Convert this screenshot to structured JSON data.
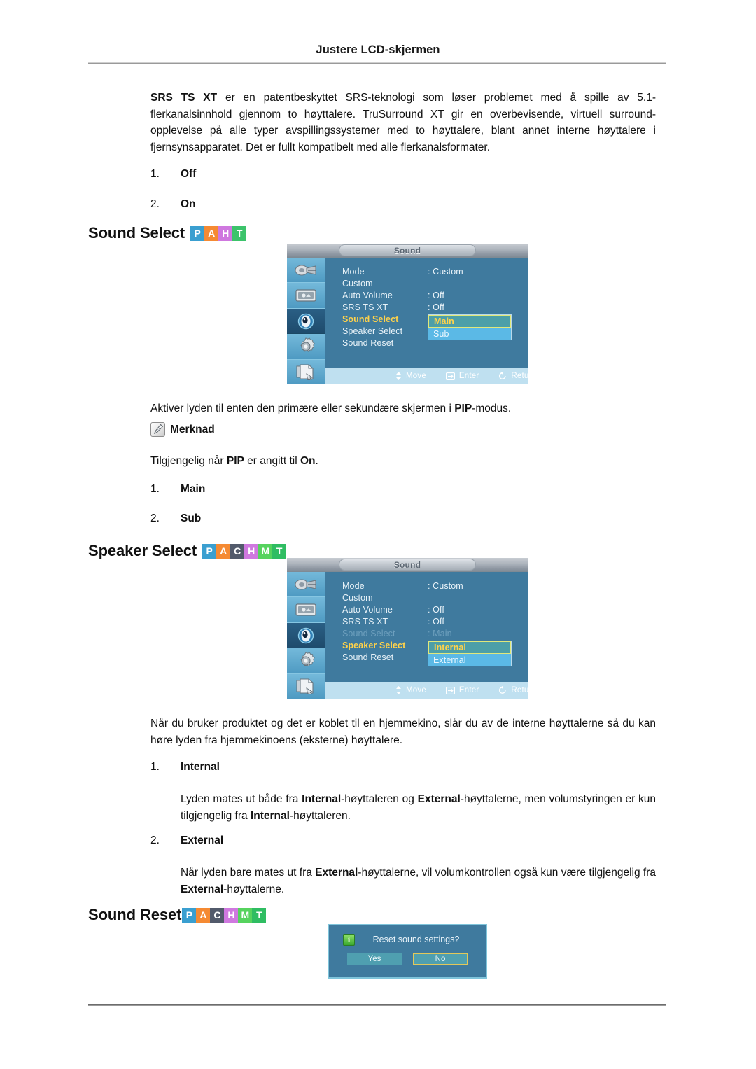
{
  "page": {
    "header_title": "Justere LCD-skjermen"
  },
  "intro": {
    "bold_lead": "SRS TS XT",
    "text": " er en patentbeskyttet SRS-teknologi som løser problemet med å spille av 5.1-flerkanalsinnhold gjennom to høyttalere. TruSurround XT gir en overbevisende, virtuell surround-opplevelse på alle typer avspillingssystemer med to høyttalere, blant annet interne høyttalere i fjernsynsapparatet. Det er fullt kompatibelt med alle flerkanalsformater.",
    "items": [
      {
        "num": "1.",
        "label": "Off"
      },
      {
        "num": "2.",
        "label": "On"
      }
    ]
  },
  "section_sound_select": {
    "heading": "Sound Select",
    "badges": [
      {
        "letter": "P",
        "color": "#3a9fd0"
      },
      {
        "letter": "A",
        "color": "#f58a33"
      },
      {
        "letter": "H",
        "color": "#cf78df"
      },
      {
        "letter": "T",
        "color": "#3cc36b"
      }
    ],
    "caption_pre": "Aktiver lyden til enten den primære eller sekundære skjermen i ",
    "caption_bold": "PIP",
    "caption_post": "-modus.",
    "note_label": "Merknad",
    "note_pre": "Tilgjengelig når ",
    "note_bold1": "PIP",
    "note_mid": " er angitt til ",
    "note_bold2": "On",
    "note_post": ".",
    "items": [
      {
        "num": "1.",
        "label": "Main"
      },
      {
        "num": "2.",
        "label": "Sub"
      }
    ]
  },
  "section_speaker_select": {
    "heading": "Speaker Select",
    "badges": [
      {
        "letter": "P",
        "color": "#3a9fd0"
      },
      {
        "letter": "A",
        "color": "#f58a33"
      },
      {
        "letter": "C",
        "color": "#525a6b"
      },
      {
        "letter": "H",
        "color": "#cf78df"
      },
      {
        "letter": "M",
        "color": "#56d35e"
      },
      {
        "letter": "T",
        "color": "#2fbd62"
      }
    ],
    "paragraph": "Når du bruker produktet og det er koblet til en hjemmekino, slår du av de interne høyttalerne så du kan høre lyden fra hjemmekinoens (eksterne) høyttalere.",
    "item1_num": "1.",
    "item1_label": "Internal",
    "item1_body_a": "Lyden mates ut både fra ",
    "item1_body_b": "Internal",
    "item1_body_c": "-høyttaleren og ",
    "item1_body_d": "External",
    "item1_body_e": "-høyttalerne, men volumstyringen er kun tilgjengelig fra ",
    "item1_body_f": "Internal",
    "item1_body_g": "-høyttaleren.",
    "item2_num": "2.",
    "item2_label": "External",
    "item2_body_a": "Når lyden bare mates ut fra ",
    "item2_body_b": "External",
    "item2_body_c": "-høyttalerne, vil volumkontrollen også kun være tilgjengelig fra ",
    "item2_body_d": "External",
    "item2_body_e": "-høyttalerne."
  },
  "section_sound_reset": {
    "heading": "Sound Reset",
    "badges": [
      {
        "letter": "P",
        "color": "#3a9fd0"
      },
      {
        "letter": "A",
        "color": "#f58a33"
      },
      {
        "letter": "C",
        "color": "#525a6b"
      },
      {
        "letter": "H",
        "color": "#cf78df"
      },
      {
        "letter": "M",
        "color": "#56d35e"
      },
      {
        "letter": "T",
        "color": "#2fbd62"
      }
    ]
  },
  "osd_menu_1": {
    "title": "Sound",
    "rows": [
      {
        "label": "Mode",
        "value": ": Custom",
        "state": "normal"
      },
      {
        "label": "Custom",
        "value": "",
        "state": "normal"
      },
      {
        "label": "Auto Volume",
        "value": ": Off",
        "state": "normal"
      },
      {
        "label": "SRS TS XT",
        "value": ": Off",
        "state": "normal"
      },
      {
        "label": "Sound Select",
        "value": ":",
        "state": "selected"
      },
      {
        "label": "Speaker Select",
        "value": "",
        "state": "normal"
      },
      {
        "label": "Sound Reset",
        "value": "",
        "state": "normal"
      }
    ],
    "dropdown": [
      {
        "label": "Main",
        "state": "highlighted"
      },
      {
        "label": "Sub",
        "state": "plain"
      }
    ],
    "nav": [
      {
        "icon": "move-updown-icon",
        "label": "Move"
      },
      {
        "icon": "enter-icon",
        "label": "Enter"
      },
      {
        "icon": "return-icon",
        "label": "Return"
      }
    ],
    "rail": [
      "input-source-icon",
      "picture-screen-icon",
      "sound-speaker-icon",
      "setup-gear-icon",
      "multi-control-icon"
    ]
  },
  "osd_menu_2": {
    "title": "Sound",
    "rows": [
      {
        "label": "Mode",
        "value": ": Custom",
        "state": "normal"
      },
      {
        "label": "Custom",
        "value": "",
        "state": "normal"
      },
      {
        "label": "Auto Volume",
        "value": ": Off",
        "state": "normal"
      },
      {
        "label": "SRS TS XT",
        "value": ": Off",
        "state": "normal"
      },
      {
        "label": "Sound Select",
        "value": ": Main",
        "state": "dimmed"
      },
      {
        "label": "Speaker Select",
        "value": ":",
        "state": "selected"
      },
      {
        "label": "Sound Reset",
        "value": "",
        "state": "normal"
      }
    ],
    "dropdown": [
      {
        "label": "Internal",
        "state": "highlighted"
      },
      {
        "label": "External",
        "state": "plain"
      }
    ],
    "nav": [
      {
        "icon": "move-updown-icon",
        "label": "Move"
      },
      {
        "icon": "enter-icon",
        "label": "Enter"
      },
      {
        "icon": "return-icon",
        "label": "Return"
      }
    ]
  },
  "reset_dialog": {
    "message": "Reset sound settings?",
    "info_glyph": "i",
    "yes_label": "Yes",
    "no_label": "No",
    "focused": "No"
  }
}
